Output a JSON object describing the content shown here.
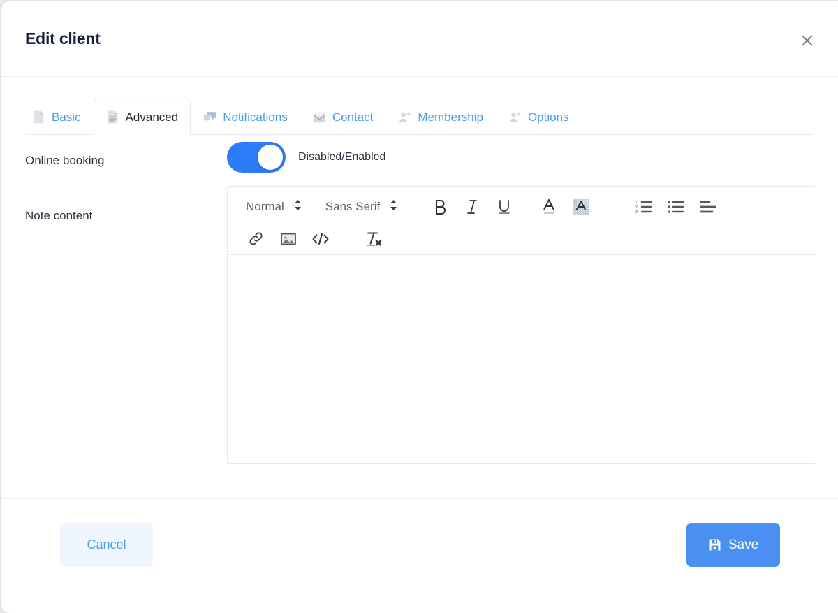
{
  "modal": {
    "title": "Edit client",
    "close_icon": "close-icon"
  },
  "tabs": [
    {
      "label": "Basic",
      "icon": "document-icon",
      "active": false
    },
    {
      "label": "Advanced",
      "icon": "document-lines-icon",
      "active": true
    },
    {
      "label": "Notifications",
      "icon": "chat-bubbles-icon",
      "active": false
    },
    {
      "label": "Contact",
      "icon": "envelope-icon",
      "active": false
    },
    {
      "label": "Membership",
      "icon": "user-plus-icon",
      "active": false
    },
    {
      "label": "Options",
      "icon": "user-plus-icon",
      "active": false
    }
  ],
  "fields": {
    "online_booking": {
      "label": "Online booking",
      "toggle_state": "on",
      "toggle_text": "Disabled/Enabled"
    },
    "note_content": {
      "label": "Note content",
      "value": "",
      "placeholder": ""
    }
  },
  "editor_toolbar": {
    "heading_select": {
      "value": "Normal",
      "icon": "chevron-updown-icon"
    },
    "font_select": {
      "value": "Sans Serif",
      "icon": "chevron-updown-icon"
    },
    "buttons_row1": [
      {
        "name": "bold-icon",
        "title": "Bold"
      },
      {
        "name": "italic-icon",
        "title": "Italic"
      },
      {
        "name": "underline-icon",
        "title": "Underline"
      },
      {
        "name": "text-color-icon",
        "title": "Text color"
      },
      {
        "name": "background-color-icon",
        "title": "Background color"
      },
      {
        "name": "ordered-list-icon",
        "title": "Ordered list"
      },
      {
        "name": "bullet-list-icon",
        "title": "Bullet list"
      },
      {
        "name": "align-left-icon",
        "title": "Align"
      }
    ],
    "buttons_row2": [
      {
        "name": "link-icon",
        "title": "Link"
      },
      {
        "name": "image-icon",
        "title": "Image"
      },
      {
        "name": "code-icon",
        "title": "Code"
      },
      {
        "name": "clear-format-icon",
        "title": "Clear formatting"
      }
    ]
  },
  "footer": {
    "cancel_label": "Cancel",
    "save_label": "Save",
    "save_icon": "save-disk-icon"
  },
  "colors": {
    "accent_blue": "#4a90f2",
    "link_blue": "#4a9ae8",
    "cancel_bg": "#eff6fd",
    "toggle_on": "#2b7cf6",
    "title_text": "#18203a",
    "border": "#e7eaee"
  }
}
